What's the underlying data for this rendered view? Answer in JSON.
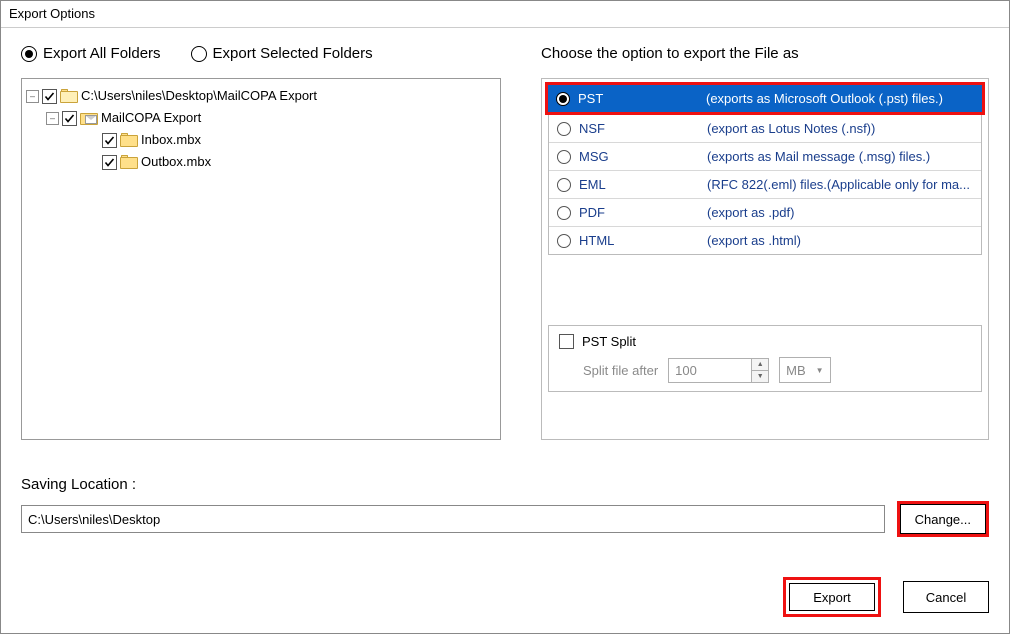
{
  "window": {
    "title": "Export Options"
  },
  "export_mode": {
    "all_label": "Export All Folders",
    "selected_label": "Export Selected Folders",
    "selected": "all"
  },
  "tree": {
    "root": {
      "label": "C:\\Users\\niles\\Desktop\\MailCOPA Export",
      "children": [
        {
          "label": "MailCOPA Export",
          "children": [
            {
              "label": "Inbox.mbx"
            },
            {
              "label": "Outbox.mbx"
            }
          ]
        }
      ]
    }
  },
  "format_section": {
    "heading": "Choose the option to export the File as",
    "options": [
      {
        "name": "PST",
        "desc": "(exports as Microsoft Outlook (.pst) files.)",
        "selected": true
      },
      {
        "name": "NSF",
        "desc": "(export as Lotus Notes (.nsf))"
      },
      {
        "name": "MSG",
        "desc": "(exports as Mail message (.msg) files.)"
      },
      {
        "name": "EML",
        "desc": "(RFC 822(.eml) files.(Applicable only for ma..."
      },
      {
        "name": "PDF",
        "desc": "(export as .pdf)"
      },
      {
        "name": "HTML",
        "desc": "(export as .html)"
      }
    ],
    "pst_split": {
      "label": "PST Split",
      "field_label": "Split file after",
      "value": "100",
      "unit": "MB"
    }
  },
  "saving": {
    "label": "Saving Location :",
    "path": "C:\\Users\\niles\\Desktop",
    "change_label": "Change..."
  },
  "buttons": {
    "export": "Export",
    "cancel": "Cancel"
  }
}
